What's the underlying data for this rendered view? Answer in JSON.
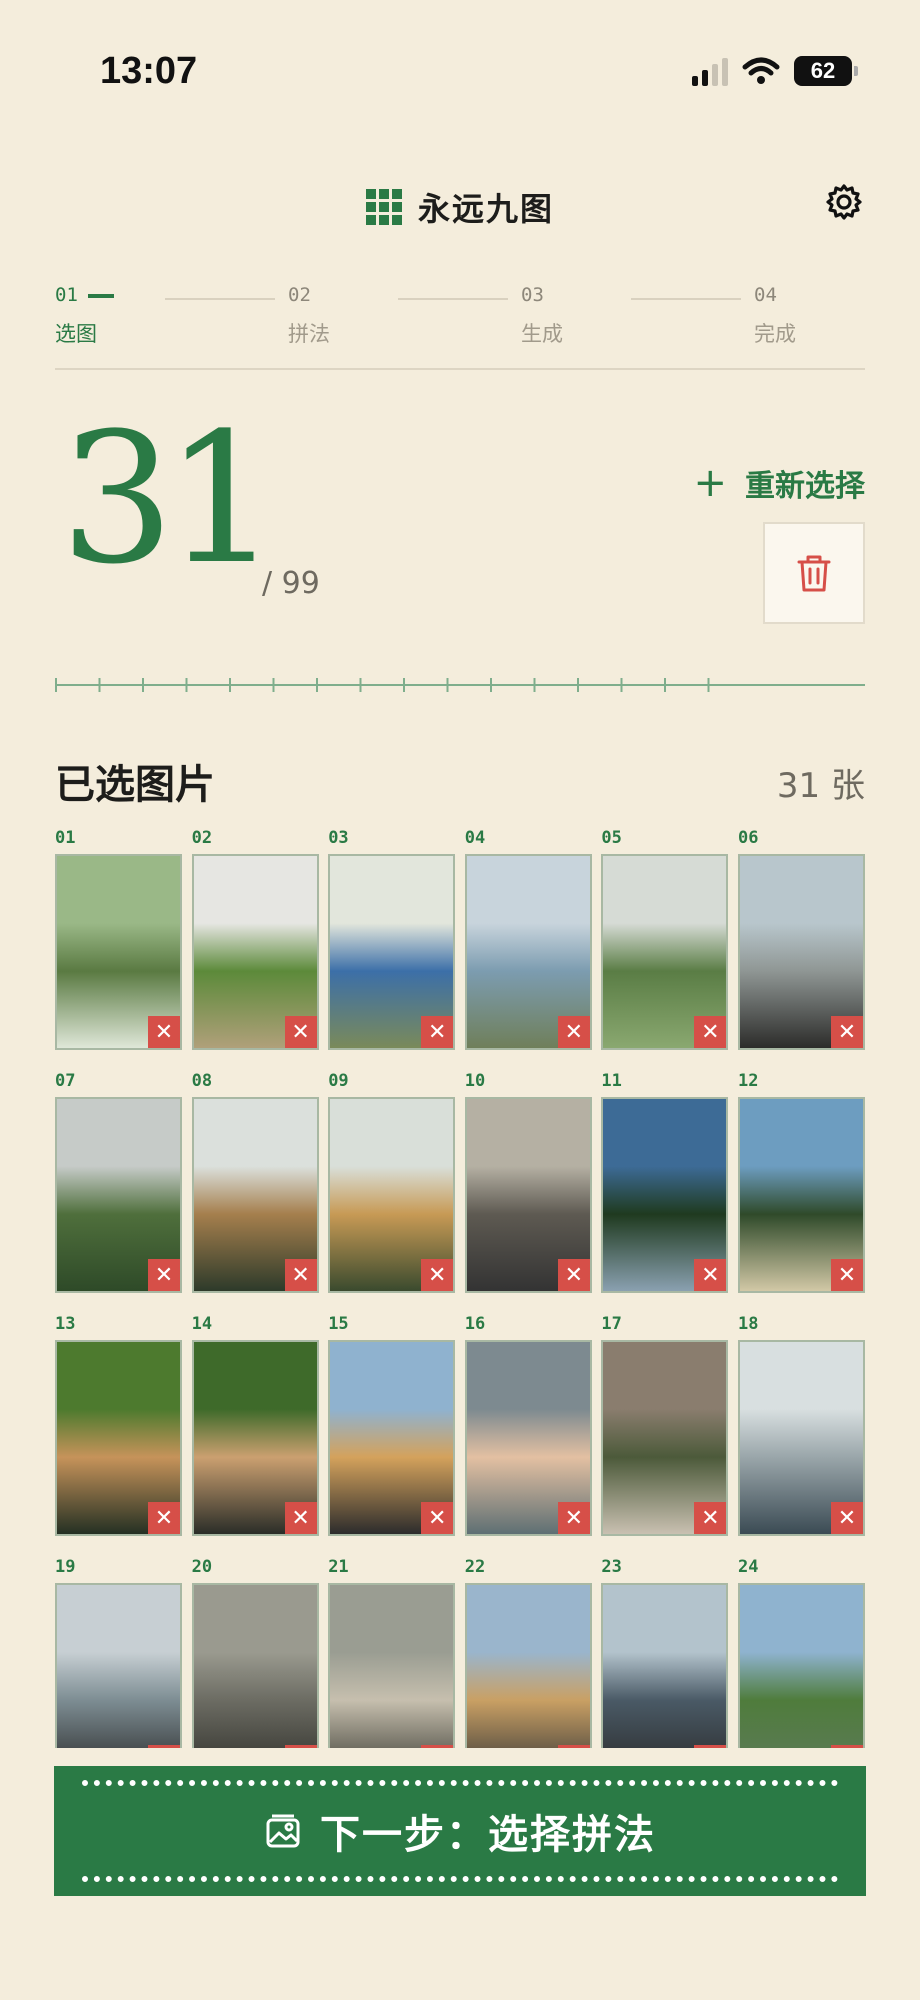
{
  "status": {
    "time": "13:07",
    "battery": "62"
  },
  "header": {
    "title": "永远九图"
  },
  "steps": [
    {
      "num": "01",
      "label": "选图",
      "active": true
    },
    {
      "num": "02",
      "label": "拼法",
      "active": false
    },
    {
      "num": "03",
      "label": "生成",
      "active": false
    },
    {
      "num": "04",
      "label": "完成",
      "active": false
    }
  ],
  "counter": {
    "selected": "31",
    "total": "/ 99"
  },
  "actions": {
    "reselect_label": "重新选择"
  },
  "section": {
    "title": "已选图片",
    "count": "31 张"
  },
  "photos": [
    {
      "num": "01",
      "palette": [
        "#9ab887",
        "#5a7a42",
        "#dfe7d8"
      ]
    },
    {
      "num": "02",
      "palette": [
        "#e6e6e2",
        "#5c8a3a",
        "#b0a07a"
      ]
    },
    {
      "num": "03",
      "palette": [
        "#e2e6dc",
        "#3c6fa8",
        "#7a8a5a"
      ]
    },
    {
      "num": "04",
      "palette": [
        "#c8d4dc",
        "#7c9cb0",
        "#6f7f5a"
      ]
    },
    {
      "num": "05",
      "palette": [
        "#d6dbd5",
        "#5a7d45",
        "#8aa870"
      ]
    },
    {
      "num": "06",
      "palette": [
        "#b8c6cc",
        "#8f9694",
        "#2c2c2a"
      ]
    },
    {
      "num": "07",
      "palette": [
        "#c6cbc8",
        "#4f6f3c",
        "#2e4a28"
      ]
    },
    {
      "num": "08",
      "palette": [
        "#dbe0dc",
        "#a57f4d",
        "#2d3a2a"
      ]
    },
    {
      "num": "09",
      "palette": [
        "#d9dfd9",
        "#c79a55",
        "#3a4a2e"
      ]
    },
    {
      "num": "10",
      "palette": [
        "#b5b0a3",
        "#5e5a52",
        "#333"
      ]
    },
    {
      "num": "11",
      "palette": [
        "#3d6b96",
        "#1f3a1f",
        "#8aa0b0"
      ]
    },
    {
      "num": "12",
      "palette": [
        "#6d9dc0",
        "#2f4a2a",
        "#d2c8a6"
      ]
    },
    {
      "num": "13",
      "palette": [
        "#4d7a2e",
        "#c6935a",
        "#243023"
      ]
    },
    {
      "num": "14",
      "palette": [
        "#3e6a2a",
        "#cba070",
        "#2a2d28"
      ]
    },
    {
      "num": "15",
      "palette": [
        "#8fb2cf",
        "#d4a25c",
        "#2c2c2c"
      ]
    },
    {
      "num": "16",
      "palette": [
        "#7d8a90",
        "#e3c0a2",
        "#5e6f73"
      ]
    },
    {
      "num": "17",
      "palette": [
        "#8a7d6e",
        "#4c5a3a",
        "#c9c0b1"
      ]
    },
    {
      "num": "18",
      "palette": [
        "#d8dfe0",
        "#9aa6aa",
        "#3b4b54"
      ]
    },
    {
      "num": "19",
      "palette": [
        "#c7cfd3",
        "#7d8d93",
        "#2a2a2a"
      ]
    },
    {
      "num": "20",
      "palette": [
        "#9a9a8f",
        "#6c6c63",
        "#2f2f2a"
      ]
    },
    {
      "num": "21",
      "palette": [
        "#9a9d92",
        "#c6bfae",
        "#3c3c34"
      ]
    },
    {
      "num": "22",
      "palette": [
        "#9ab5cc",
        "#c9a064",
        "#373737"
      ]
    },
    {
      "num": "23",
      "palette": [
        "#b3c3cc",
        "#4a5a66",
        "#2a2a2a"
      ]
    },
    {
      "num": "24",
      "palette": [
        "#8fb3cf",
        "#4f7c3c",
        "#5e7a5a"
      ]
    }
  ],
  "next": {
    "label": "下一步：选择拼法"
  },
  "colors": {
    "accent": "#2a7a45",
    "background": "#f4eddc",
    "remove": "#d64f48"
  }
}
